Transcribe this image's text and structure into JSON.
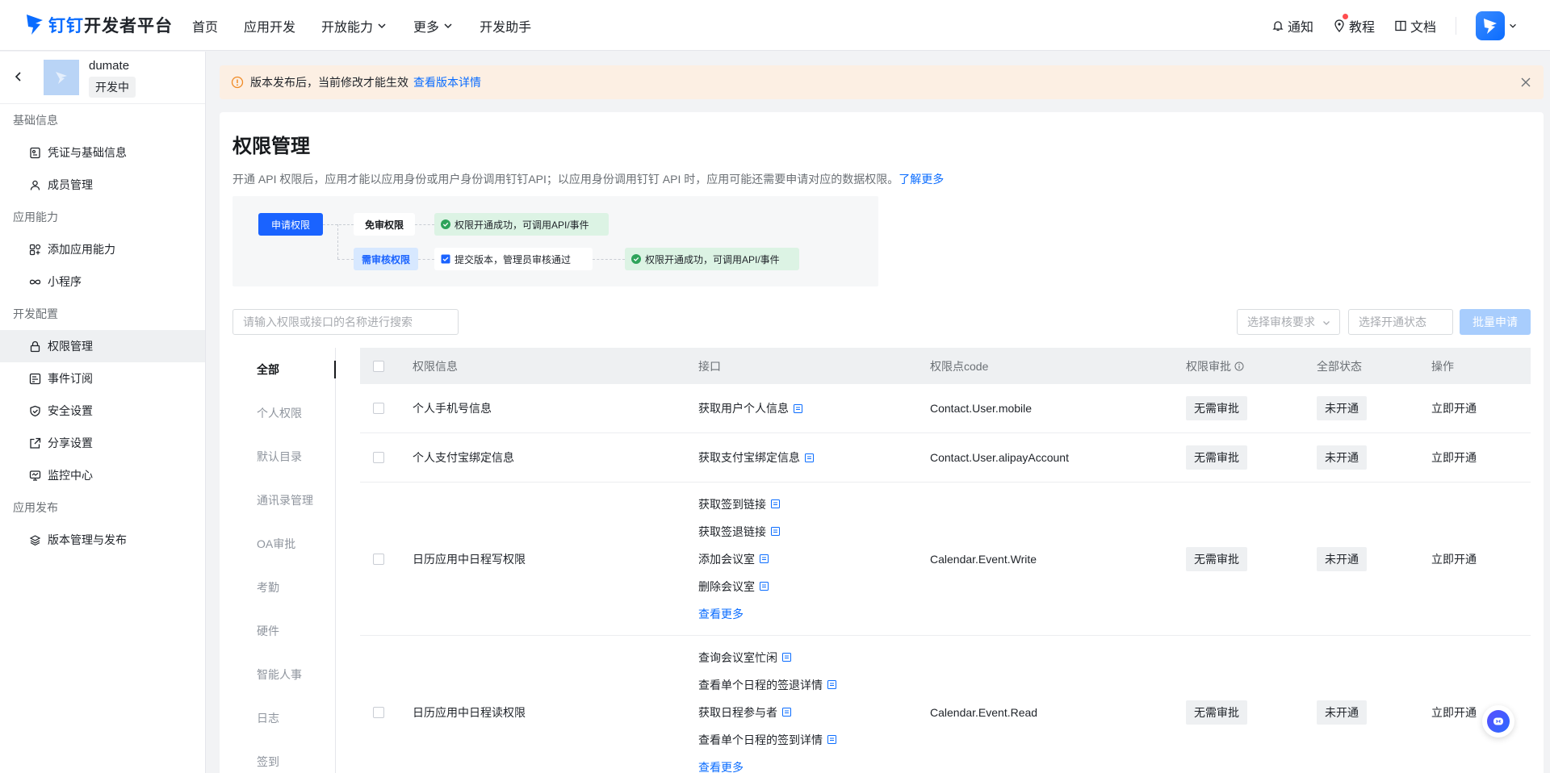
{
  "brand": {
    "logo_text_blue": "钉钉",
    "logo_text": "开发者平台"
  },
  "nav": {
    "items": [
      {
        "label": "首页",
        "dropdown": false
      },
      {
        "label": "应用开发",
        "dropdown": false
      },
      {
        "label": "开放能力",
        "dropdown": true
      },
      {
        "label": "更多",
        "dropdown": true
      },
      {
        "label": "开发助手",
        "dropdown": false
      }
    ],
    "right": {
      "notify": "通知",
      "tutorial": "教程",
      "docs": "文档"
    }
  },
  "app": {
    "name": "dumate",
    "status": "开发中"
  },
  "sidebar": {
    "groups": [
      {
        "title": "基础信息",
        "items": [
          {
            "label": "凭证与基础信息",
            "icon": "id-card-icon"
          },
          {
            "label": "成员管理",
            "icon": "user-icon"
          }
        ]
      },
      {
        "title": "应用能力",
        "items": [
          {
            "label": "添加应用能力",
            "icon": "apps-plus-icon"
          },
          {
            "label": "小程序",
            "icon": "infinity-icon"
          }
        ]
      },
      {
        "title": "开发配置",
        "items": [
          {
            "label": "权限管理",
            "icon": "lock-icon",
            "active": true
          },
          {
            "label": "事件订阅",
            "icon": "event-icon"
          },
          {
            "label": "安全设置",
            "icon": "shield-icon"
          },
          {
            "label": "分享设置",
            "icon": "share-icon"
          },
          {
            "label": "监控中心",
            "icon": "monitor-icon"
          }
        ]
      },
      {
        "title": "应用发布",
        "items": [
          {
            "label": "版本管理与发布",
            "icon": "layers-icon"
          }
        ]
      }
    ]
  },
  "notice": {
    "text": "版本发布后，当前修改才能生效",
    "link": "查看版本详情"
  },
  "page": {
    "title": "权限管理",
    "desc": "开通 API 权限后，应用才能以应用身份或用户身份调用钉钉API；以应用身份调用钉钉 API 时，应用可能还需要申请对应的数据权限。",
    "desc_link": "了解更多"
  },
  "flow": {
    "apply": "申请权限",
    "free": "免审权限",
    "review": "需审核权限",
    "ok": "权限开通成功，可调用API/事件",
    "submit": "提交版本，管理员审核通过"
  },
  "filters": {
    "search_placeholder": "请输入权限或接口的名称进行搜索",
    "audit_placeholder": "选择审核要求",
    "state_placeholder": "选择开通状态",
    "batch": "批量申请"
  },
  "categories": [
    "全部",
    "个人权限",
    "默认目录",
    "通讯录管理",
    "OA审批",
    "考勤",
    "硬件",
    "智能人事",
    "日志",
    "签到"
  ],
  "table": {
    "headers": {
      "info": "权限信息",
      "api": "接口",
      "code": "权限点code",
      "audit": "权限审批",
      "state": "全部状态",
      "op": "操作"
    },
    "rows": [
      {
        "info": "个人手机号信息",
        "apis": [
          "获取用户个人信息"
        ],
        "more": "",
        "code": "Contact.User.mobile",
        "audit": "无需审批",
        "state": "未开通",
        "op": "立即开通"
      },
      {
        "info": "个人支付宝绑定信息",
        "apis": [
          "获取支付宝绑定信息"
        ],
        "more": "",
        "code": "Contact.User.alipayAccount",
        "audit": "无需审批",
        "state": "未开通",
        "op": "立即开通"
      },
      {
        "info": "日历应用中日程写权限",
        "apis": [
          "获取签到链接",
          "获取签退链接",
          "添加会议室",
          "删除会议室"
        ],
        "more": "查看更多",
        "code": "Calendar.Event.Write",
        "audit": "无需审批",
        "state": "未开通",
        "op": "立即开通"
      },
      {
        "info": "日历应用中日程读权限",
        "apis": [
          "查询会议室忙闲",
          "查看单个日程的签退详情",
          "获取日程参与者",
          "查看单个日程的签到详情"
        ],
        "more": "查看更多",
        "code": "Calendar.Event.Read",
        "audit": "无需审批",
        "state": "未开通",
        "op": "立即开通"
      }
    ]
  }
}
